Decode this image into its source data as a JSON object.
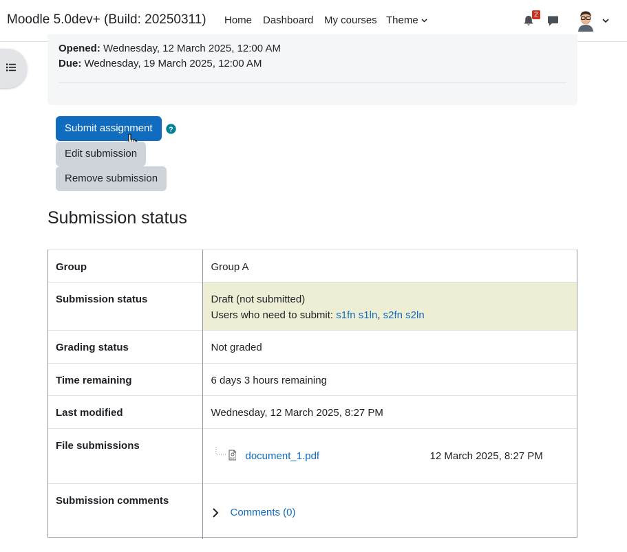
{
  "navbar": {
    "brand": "Moodle 5.0dev+ (Build: 20250311)",
    "links": {
      "home": "Home",
      "dashboard": "Dashboard",
      "my_courses": "My courses",
      "theme": "Theme"
    },
    "notification_count": "2"
  },
  "dates": {
    "opened_label": "Opened:",
    "opened_value": "Wednesday, 12 March 2025, 12:00 AM",
    "due_label": "Due:",
    "due_value": "Wednesday, 19 March 2025, 12:00 AM"
  },
  "actions": {
    "submit": "Submit assignment",
    "edit": "Edit submission",
    "remove": "Remove submission"
  },
  "section_title": "Submission status",
  "status": {
    "group_label": "Group",
    "group_value": "Group A",
    "submission_label": "Submission status",
    "submission_value": "Draft (not submitted)",
    "users_prefix": "Users who need to submit: ",
    "user1": "s1fn s1ln",
    "user_sep": ", ",
    "user2": "s2fn s2ln",
    "grading_label": "Grading status",
    "grading_value": "Not graded",
    "time_label": "Time remaining",
    "time_value": "6 days 3 hours remaining",
    "modified_label": "Last modified",
    "modified_value": "Wednesday, 12 March 2025, 8:27 PM",
    "files_label": "File submissions",
    "file_name": "document_1.pdf",
    "file_date": "12 March 2025, 8:27 PM",
    "comments_label": "Submission comments",
    "comments_link": "Comments (0)"
  },
  "colors": {
    "primary": "#0f6cbf",
    "draft_highlight": "#eeeed5",
    "badge": "#ca3120",
    "help": "#008196"
  }
}
